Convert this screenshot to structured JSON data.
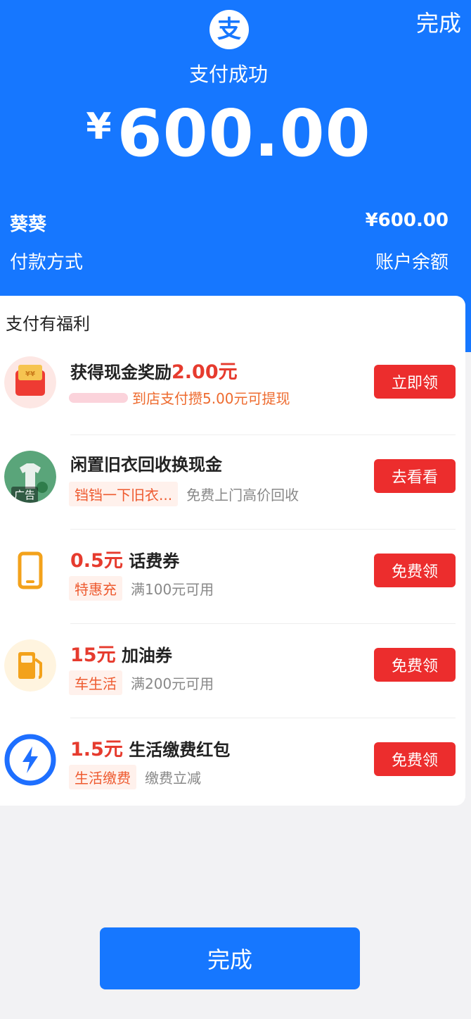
{
  "header": {
    "done_link": "完成",
    "logo_char": "支",
    "status": "支付成功",
    "currency": "¥",
    "amount": "600.00",
    "payee": "葵葵",
    "payee_amount": "¥600.00",
    "method_label": "付款方式",
    "method_value": "账户余额"
  },
  "benefits": {
    "title": "支付有福利",
    "items": [
      {
        "title": "获得现金奖励",
        "highlight": "2.00元",
        "subtitle": "到店支付攒5.00元可提现",
        "button": "立即领",
        "icon": "red-envelope-icon"
      },
      {
        "title": "闲置旧衣回收换现金",
        "tag": "铛铛一下旧衣...",
        "subtitle": "免费上门高价回收",
        "button": "去看看",
        "ad": "广告",
        "icon": "clothes-recycling-icon"
      },
      {
        "highlight": "0.5元",
        "title": "话费券",
        "tag": "特惠充",
        "subtitle": "满100元可用",
        "button": "免费领",
        "icon": "phone-icon"
      },
      {
        "highlight": "15元",
        "title": "加油券",
        "tag": "车生活",
        "subtitle": "满200元可用",
        "button": "免费领",
        "icon": "fuel-pump-icon"
      },
      {
        "highlight": "1.5元",
        "title": "生活缴费红包",
        "tag": "生活缴费",
        "subtitle": "缴费立减",
        "button": "免费领",
        "icon": "lightning-icon"
      }
    ]
  },
  "footer": {
    "done_button": "完成"
  },
  "colors": {
    "brand_blue": "#1677ff",
    "button_red": "#ec2d2d",
    "highlight_red": "#e63b2e"
  }
}
